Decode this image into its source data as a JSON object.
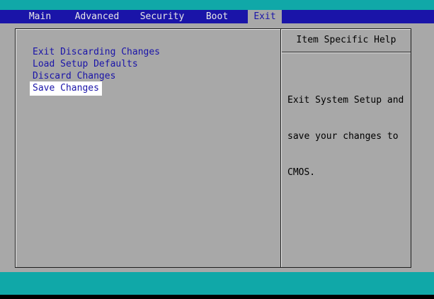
{
  "menubar": {
    "tabs": [
      {
        "label": "Main"
      },
      {
        "label": "Advanced"
      },
      {
        "label": "Security"
      },
      {
        "label": "Boot"
      },
      {
        "label": "Exit"
      }
    ],
    "active_tab": "Exit"
  },
  "options": [
    {
      "label": "Exit Discarding Changes"
    },
    {
      "label": "Load Setup Defaults"
    },
    {
      "label": "Discard Changes"
    },
    {
      "label": "Save Changes"
    }
  ],
  "selected_option": "Save Changes",
  "help": {
    "title": "Item Specific Help",
    "lines": [
      "Exit System Setup and",
      "save your changes to",
      "CMOS."
    ]
  },
  "colors": {
    "background": "#a8a8a8",
    "menubar": "#1a14a8",
    "accent_teal": "#10a8a8",
    "option_text": "#1a14a8",
    "selection": "#ffffff"
  }
}
